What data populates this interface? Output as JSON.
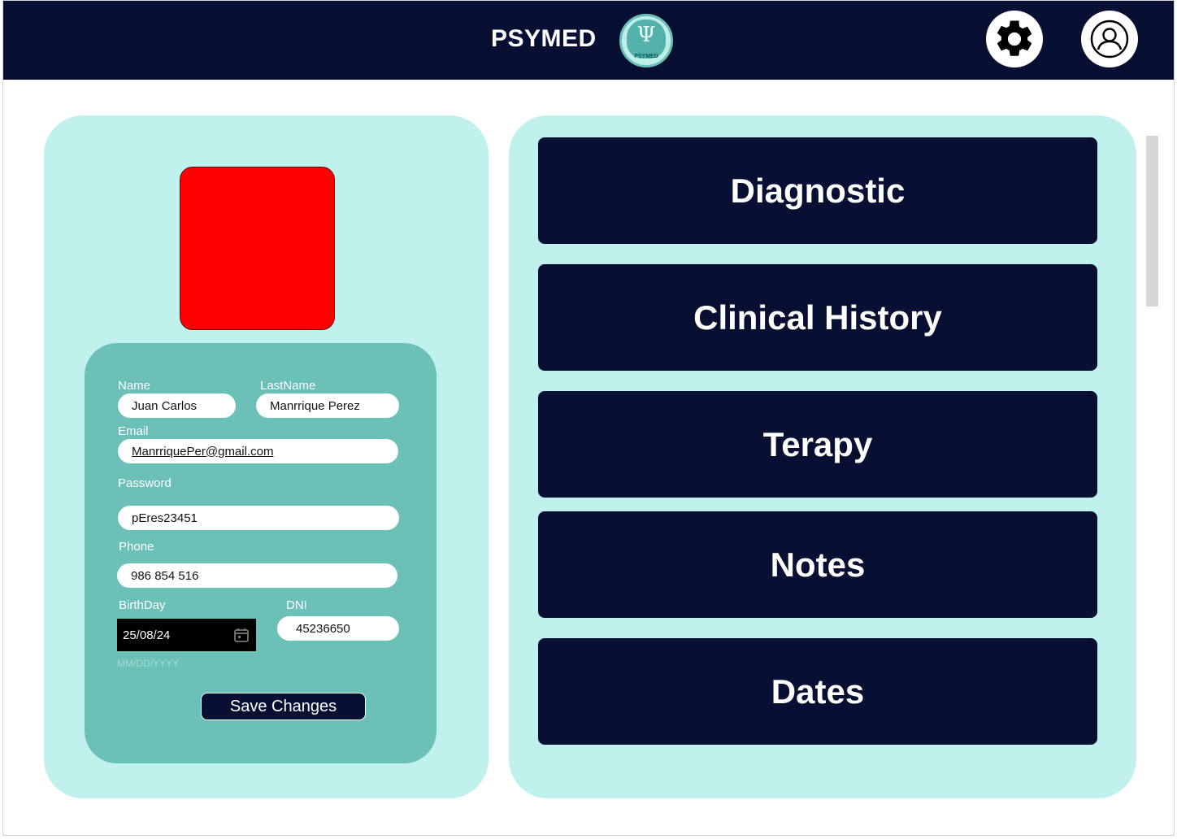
{
  "header": {
    "title": "PSYMED",
    "logo_symbol": "Ψ",
    "logo_text": "PSYMED",
    "settings_icon": "gear-icon",
    "profile_icon": "user-circle-icon"
  },
  "profile": {
    "photo_color": "#ff0000",
    "form": {
      "name_label": "Name",
      "name_value": "Juan Carlos",
      "lastname_label": "LastName",
      "lastname_value": "Manrrique Perez",
      "email_label": "Email",
      "email_value": "ManrriquePer@gmail.com",
      "password_label": "Password",
      "password_value": "pEres23451",
      "phone_label": "Phone",
      "phone_value": "986 854 516",
      "birthday_label": "BirthDay",
      "birthday_value": "25/08/24",
      "birthday_hint": "MM/DD/YYYY",
      "dni_label": "DNI",
      "dni_value": "45236650",
      "save_label": "Save Changes"
    }
  },
  "menu": {
    "items": [
      {
        "label": "Diagnostic"
      },
      {
        "label": "Clinical History"
      },
      {
        "label": "Terapy"
      },
      {
        "label": "Notes"
      },
      {
        "label": "Dates"
      }
    ]
  },
  "colors": {
    "navy": "#071033",
    "panel": "#c1f1ec",
    "card": "#6bc0b8"
  }
}
